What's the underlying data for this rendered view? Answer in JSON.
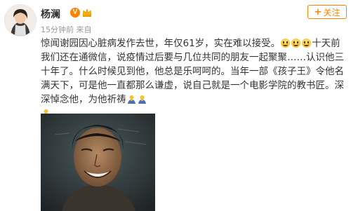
{
  "user": {
    "name": "杨澜",
    "verified_badge": "V"
  },
  "follow_button": {
    "label": "关注",
    "icon": "plus-icon",
    "color": "#ff8200"
  },
  "meta": {
    "time": "15分钟前",
    "source": "来自"
  },
  "post": {
    "text_part1": "惊闻谢园因心脏病发作去世，年仅61岁，实在难以接受。",
    "text_part2": "十天前我们还在通微信，说疫情过后要与几位共同的朋友一起聚聚……认识他三十年了。什么时候见到他，他总是乐呵呵的。当年一部《孩子王》令他名满天下，可是他一直都那么谦虚，说自己就是一个电影学院的教书匠。深深悼念他，为他祈祷",
    "emoji_cry_count": 3,
    "emoji_pray_count": 3
  },
  "colors": {
    "accent": "#ff8200",
    "meta_text": "#999999",
    "body_text": "#333333"
  }
}
